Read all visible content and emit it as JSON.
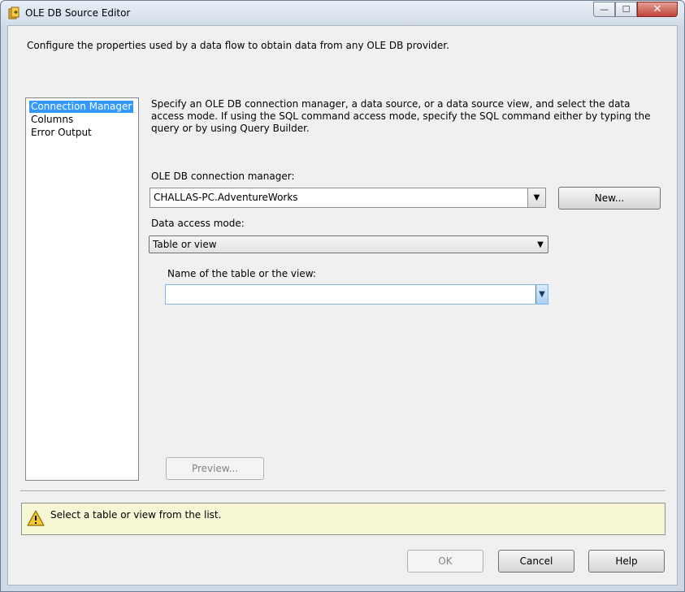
{
  "window": {
    "title": "OLE DB Source Editor",
    "description": "Configure the properties used by a data flow to obtain data from any OLE DB provider.",
    "controls": {
      "minimize": "—",
      "maximize": "☐",
      "close": "✕"
    }
  },
  "nav": {
    "items": [
      {
        "label": "Connection Manager",
        "selected": true
      },
      {
        "label": "Columns",
        "selected": false
      },
      {
        "label": "Error Output",
        "selected": false
      }
    ]
  },
  "panel": {
    "help_text": "Specify an OLE DB connection manager, a data source, or a data source view, and select the data access mode. If using the SQL command access mode, specify the SQL command either by typing the query or by using Query Builder.",
    "connection_label": "OLE DB connection manager:",
    "connection_value": "CHALLAS-PC.AdventureWorks",
    "new_button": "New...",
    "access_mode_label": "Data access mode:",
    "access_mode_value": "Table or view",
    "table_label": "Name of the table or the view:",
    "table_value": "",
    "preview_button": "Preview..."
  },
  "status": {
    "message": "Select a table or view from the list."
  },
  "footer": {
    "ok_label": "OK",
    "cancel_label": "Cancel",
    "help_label": "Help"
  }
}
